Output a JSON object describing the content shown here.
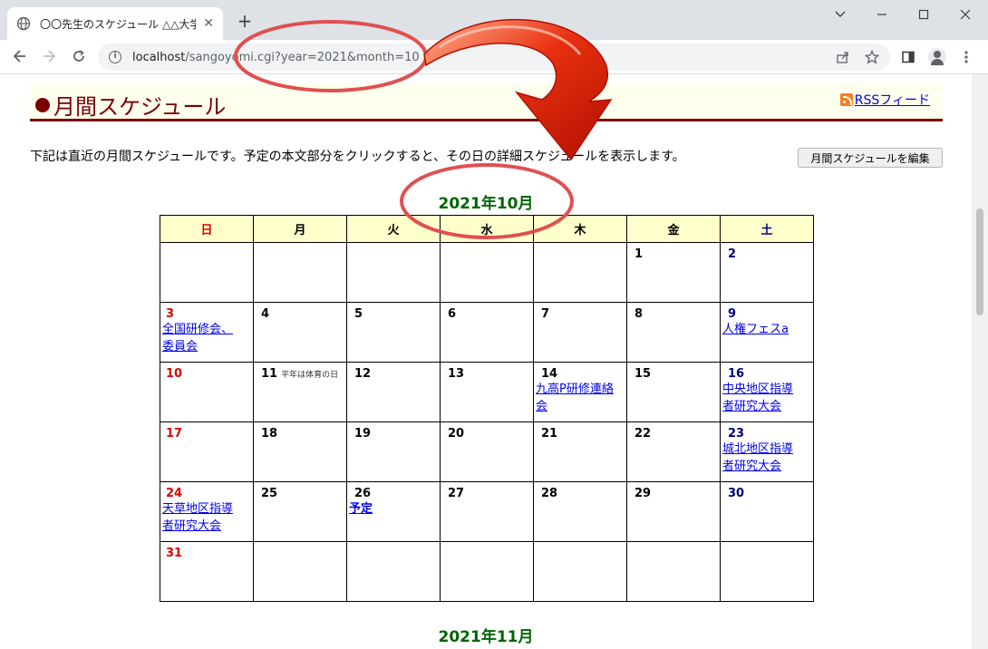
{
  "browser": {
    "tab_title": "〇〇先生のスケジュール △△大学☆",
    "url_host": "localhost",
    "url_path": "/sangoyomi.cgi?year=2021&month=10",
    "close_glyph": "✕",
    "new_tab_glyph": "+"
  },
  "page": {
    "header_title": "月間スケジュール",
    "rss_label": "RSSフィード",
    "description": "下記は直近の月間スケジュールです。予定の本文部分をクリックすると、その日の詳細スケジュールを表示します。",
    "edit_button": "月間スケジュールを編集",
    "month_title": "2021年10月",
    "next_month_title": "2021年11月"
  },
  "calendar": {
    "weekdays": [
      "日",
      "月",
      "火",
      "水",
      "木",
      "金",
      "土"
    ],
    "weeks": [
      [
        {
          "day": "",
          "note": "",
          "events": []
        },
        {
          "day": "",
          "note": "",
          "events": []
        },
        {
          "day": "",
          "note": "",
          "events": []
        },
        {
          "day": "",
          "note": "",
          "events": []
        },
        {
          "day": "",
          "note": "",
          "events": []
        },
        {
          "day": "1",
          "note": "",
          "events": []
        },
        {
          "day": "2",
          "note": "",
          "events": []
        }
      ],
      [
        {
          "day": "3",
          "note": "",
          "events": [
            "全国研修会、",
            "委員会"
          ]
        },
        {
          "day": "4",
          "note": "",
          "events": []
        },
        {
          "day": "5",
          "note": "",
          "events": []
        },
        {
          "day": "6",
          "note": "",
          "events": []
        },
        {
          "day": "7",
          "note": "",
          "events": []
        },
        {
          "day": "8",
          "note": "",
          "events": []
        },
        {
          "day": "9",
          "note": "",
          "events": [
            "人権フェスa"
          ]
        }
      ],
      [
        {
          "day": "10",
          "note": "",
          "events": []
        },
        {
          "day": "11",
          "note": "平年は体育の日",
          "events": []
        },
        {
          "day": "12",
          "note": "",
          "events": []
        },
        {
          "day": "13",
          "note": "",
          "events": []
        },
        {
          "day": "14",
          "note": "",
          "events": [
            "九高P研修連絡",
            "会"
          ]
        },
        {
          "day": "15",
          "note": "",
          "events": []
        },
        {
          "day": "16",
          "note": "",
          "events": [
            "中央地区指導",
            "者研究大会"
          ]
        }
      ],
      [
        {
          "day": "17",
          "note": "",
          "events": []
        },
        {
          "day": "18",
          "note": "",
          "events": []
        },
        {
          "day": "19",
          "note": "",
          "events": []
        },
        {
          "day": "20",
          "note": "",
          "events": []
        },
        {
          "day": "21",
          "note": "",
          "events": []
        },
        {
          "day": "22",
          "note": "",
          "events": []
        },
        {
          "day": "23",
          "note": "",
          "events": [
            "城北地区指導",
            "者研究大会"
          ]
        }
      ],
      [
        {
          "day": "24",
          "note": "",
          "events": [
            "天草地区指導",
            "者研究大会"
          ]
        },
        {
          "day": "25",
          "note": "",
          "events": []
        },
        {
          "day": "26",
          "note": "",
          "events": [
            "予定"
          ],
          "bold": true
        },
        {
          "day": "27",
          "note": "",
          "events": []
        },
        {
          "day": "28",
          "note": "",
          "events": []
        },
        {
          "day": "29",
          "note": "",
          "events": []
        },
        {
          "day": "30",
          "note": "",
          "events": []
        }
      ],
      [
        {
          "day": "31",
          "note": "",
          "events": []
        },
        {
          "day": "",
          "note": "",
          "events": []
        },
        {
          "day": "",
          "note": "",
          "events": []
        },
        {
          "day": "",
          "note": "",
          "events": []
        },
        {
          "day": "",
          "note": "",
          "events": []
        },
        {
          "day": "",
          "note": "",
          "events": []
        },
        {
          "day": "",
          "note": "",
          "events": []
        }
      ]
    ]
  },
  "colors": {
    "header_bg": "#ffffee",
    "header_accent": "#7a0000",
    "month_title": "#006400",
    "sunday": "#dd0000",
    "saturday": "#000080",
    "annotation_red": "#e05050"
  }
}
